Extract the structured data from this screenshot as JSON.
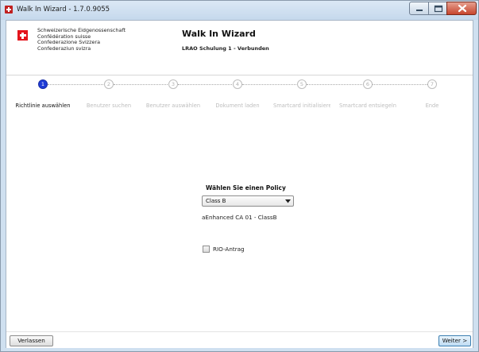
{
  "window": {
    "title": "Walk In Wizard - 1.7.0.9055",
    "controls": [
      "minimize-icon",
      "maximize-icon",
      "close-icon"
    ]
  },
  "header": {
    "confederation": [
      "Schweizerische Eidgenossenschaft",
      "Confédération suisse",
      "Confederazione Svizzera",
      "Confederaziun svizra"
    ],
    "title": "Walk In Wizard",
    "subtitle": "LRAO Schulung 1 - Verbunden"
  },
  "steps": [
    {
      "number": "1",
      "label": "Richtlinie auswählen",
      "active": true
    },
    {
      "number": "2",
      "label": "Benutzer suchen",
      "active": false
    },
    {
      "number": "3",
      "label": "Benutzer auswählen",
      "active": false
    },
    {
      "number": "4",
      "label": "Dokument laden",
      "active": false
    },
    {
      "number": "5",
      "label": "Smartcard initialisieren",
      "active": false
    },
    {
      "number": "6",
      "label": "Smartcard entsiegeln",
      "active": false
    },
    {
      "number": "7",
      "label": "Ende",
      "active": false
    }
  ],
  "policy": {
    "label": "Wählen Sie einen Policy",
    "selected": "Class B",
    "description": "aEnhanced CA 01 - ClassB"
  },
  "rio": {
    "label": "RIO-Antrag",
    "checked": false
  },
  "footer": {
    "leave_label": "Verlassen",
    "next_label": "Weiter >"
  },
  "colors": {
    "active_step": "#1e3bd6",
    "swiss_red": "#e4141c",
    "close_button": "#c7452d"
  }
}
